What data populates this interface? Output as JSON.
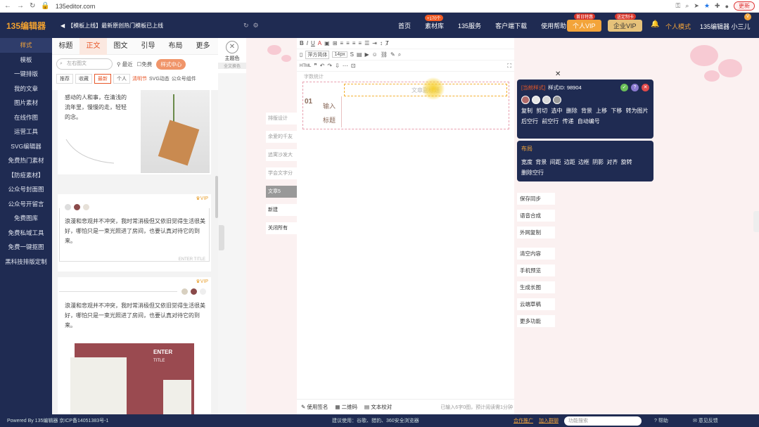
{
  "browser": {
    "url": "135editor.com",
    "update_label": "更新"
  },
  "topbar": {
    "logo": "135编辑器",
    "notice": "【模板上线】最新原创热门模板已上线",
    "nav": [
      {
        "label": "首页",
        "badge": ""
      },
      {
        "label": "素材库",
        "badge": "+170个"
      },
      {
        "label": "135服务",
        "badge": ""
      },
      {
        "label": "客户端下载",
        "badge": ""
      },
      {
        "label": "使用帮助",
        "badge": ""
      }
    ],
    "vip_personal": {
      "label": "个人VIP",
      "badge": "首日特惠"
    },
    "vip_enterprise": {
      "label": "企业VIP",
      "badge": "送定制卡"
    },
    "mode": "个人模式",
    "user": "135编辑器 小三儿"
  },
  "sidebar": {
    "items": [
      {
        "label": "样式",
        "active": true
      },
      {
        "label": "模板"
      },
      {
        "label": "一键排版"
      },
      {
        "label": "我的文章"
      },
      {
        "label": "图片素材"
      },
      {
        "label": "在线作图"
      },
      {
        "label": "运营工具"
      },
      {
        "label": "SVG编辑器"
      },
      {
        "label": "免费热门素材"
      },
      {
        "label": "【防疫素材】"
      },
      {
        "label": "公众号封面图"
      },
      {
        "label": "公众号开留言"
      },
      {
        "label": "免费图库"
      },
      {
        "label": "免费私域工具"
      },
      {
        "label": "免费一键抠图"
      },
      {
        "label": "黑科技排版定制"
      }
    ]
  },
  "panel": {
    "tabs": [
      "标题",
      "正文",
      "图文",
      "引导",
      "布局",
      "更多"
    ],
    "active_tab": "正文",
    "search_placeholder": "左右图文",
    "recent": "最近",
    "free": "免费",
    "style_center": "样式中心",
    "filters": [
      "推荐",
      "收藏",
      "最新",
      "个人"
    ],
    "filter_links": [
      "清明节",
      "SVG动态",
      "公众号组件"
    ],
    "theme": {
      "label": "主题色",
      "sub": "全文换色"
    },
    "card1_text": "感动的人和事，在清浅的流年里，慢慢的走，轻轻的念。",
    "card2_text": "浪漫和悲观并不冲突，我时常消极但又依旧觉得生活很美好，哪怕只是一束光照进了房间，也要认真对待它的到来。",
    "card2_foot": "ENTER TITLE",
    "card3_text": "浪漫和悲观并不冲突，我时常消极但又依旧觉得生活很美好，哪怕只是一束光照进了房间，也要认真对待它的到来。",
    "card3_title1": "ENTER",
    "card3_title2": "TITLE",
    "vip": "VIP"
  },
  "midlist": [
    {
      "label": "排版设计",
      "state": "dim"
    },
    {
      "label": "余爱的千友",
      "state": "dim"
    },
    {
      "label": "追寓沙发大",
      "state": "dim"
    },
    {
      "label": "学会文字分",
      "state": "dim"
    },
    {
      "label": "文章5",
      "state": "sel"
    },
    {
      "label": "新建",
      "state": "plain"
    },
    {
      "label": "关闭所有",
      "state": "plain"
    }
  ],
  "editor": {
    "font": "萍方简体",
    "size": "14px",
    "note": "字数统计",
    "title_placeholder": "文章副标题",
    "num": "01",
    "input_label": "输入标题",
    "footer": {
      "sign": "使用签名",
      "qr": "二维码",
      "check": "文本校对",
      "status": "已输入6字0图，预计阅读需1分钟"
    }
  },
  "toolbox": {
    "tag": "[当前样式]",
    "style_id": "样式ID: 98904",
    "colors": [
      "#b06a6a",
      "#e6e6e6",
      "#d8d8d8",
      "#999999"
    ],
    "row1": [
      "复制",
      "剪切",
      "选中",
      "删除",
      "背景",
      "上移",
      "下移",
      "转为图片"
    ],
    "row2": [
      "后空行",
      "前空行",
      "传递",
      "自动编号"
    ]
  },
  "layout": {
    "title": "布局",
    "row1": [
      "宽度",
      "背景",
      "间距",
      "边距",
      "边框",
      "阴影",
      "对齐",
      "旋转"
    ],
    "row2": [
      "删除空行"
    ]
  },
  "rbuttons": [
    "保存同步",
    "语音合成",
    "外网复制",
    "清空内容",
    "手机预览",
    "生成长图",
    "云端草稿",
    "更多功能"
  ],
  "footer": {
    "left": "Powered By 135编辑器 京ICP备14051383号-1",
    "mid": "建议使用：谷歌、猎豹、360安全浏览器",
    "coop": "合作推广",
    "join": "加入群聊",
    "search_placeholder": "功能搜索",
    "help": "帮助",
    "feedback": "意见反馈"
  },
  "colors": {
    "navy": "#1f2b52",
    "accent": "#f3a43a",
    "orange": "#e8582a"
  }
}
